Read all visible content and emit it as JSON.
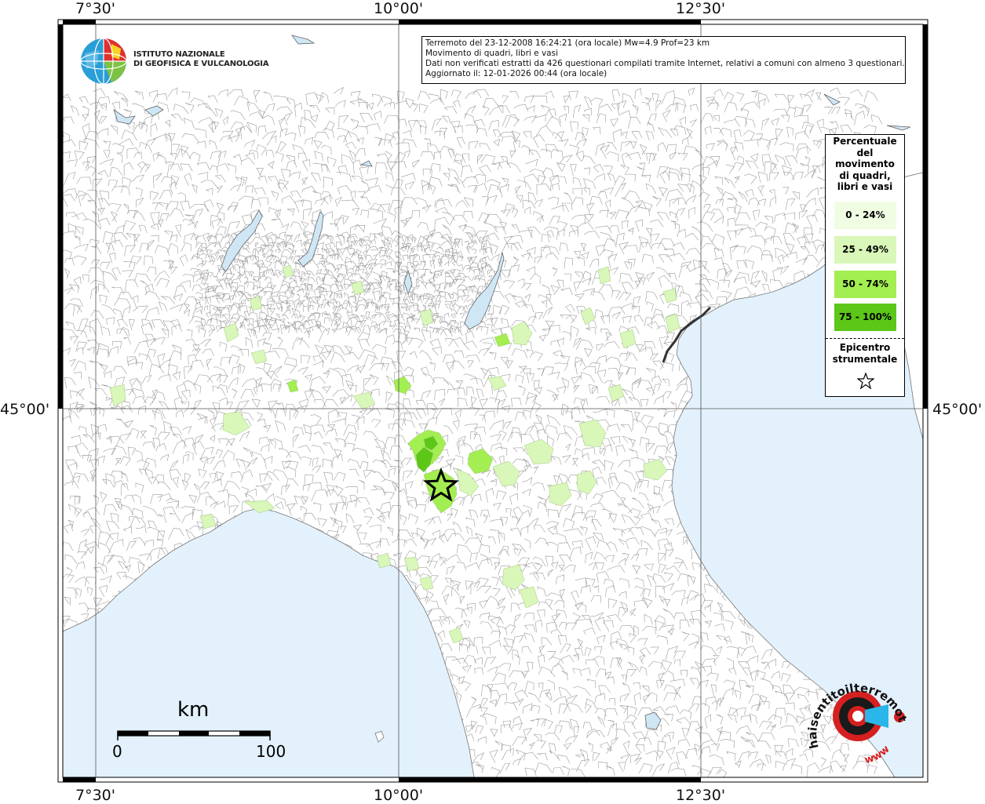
{
  "map": {
    "top_labels": [
      "7°30'",
      "10°00'",
      "12°30'"
    ],
    "bottom_labels": [
      "7°30'",
      "10°00'",
      "12°30'"
    ],
    "left_label": "45°00'",
    "right_label": "45°00'",
    "colors": {
      "sea": "#e2f1fb",
      "land": "#ffffff",
      "border": "#8a8a8a",
      "frame": "#000000",
      "grid": "#555555"
    }
  },
  "logo": {
    "line1": "ISTITUTO NAZIONALE",
    "line2": "DI GEOFISICA E VULCANOLOGIA"
  },
  "info": {
    "line1": "Terremoto del 23-12-2008 16:24:21 (ora locale) Mw=4.9 Prof=23 km",
    "line2": "Movimento di quadri, libri e vasi",
    "line3": "Dati non verificati estratti da 426 questionari compilati tramite Internet, relativi a comuni con almeno 3 questionari.",
    "line4": "Aggiornato il: 12-01-2026 00:44 (ora locale)"
  },
  "legend": {
    "title_lines": [
      "Percentuale",
      "del",
      "movimento",
      "di quadri,",
      "libri e vasi"
    ],
    "classes": [
      {
        "label": "0 - 24%",
        "color": "#f0fde3"
      },
      {
        "label": "25 - 49%",
        "color": "#d9f7b8"
      },
      {
        "label": "50 - 74%",
        "color": "#a3ee50"
      },
      {
        "label": "75 - 100%",
        "color": "#5cc717"
      }
    ],
    "epicenter_lines": [
      "Epicentro",
      "strumentale"
    ]
  },
  "scalebar": {
    "unit": "km",
    "start": "0",
    "end": "100"
  },
  "watermark": {
    "text": "haisentitoilterremoto.it",
    "url": "www"
  }
}
